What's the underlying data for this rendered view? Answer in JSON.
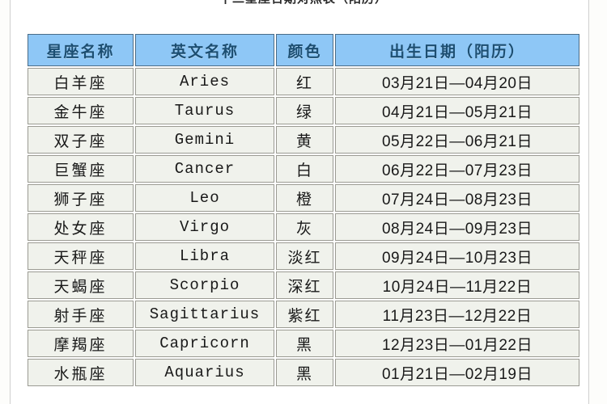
{
  "page": {
    "title_partial": "十二星座日期对照表（阳历）"
  },
  "table": {
    "name": "zodiac-date-table",
    "headers": [
      "星座名称",
      "英文名称",
      "颜色",
      "出生日期（阳历）"
    ],
    "rows": [
      {
        "cn": "白羊座",
        "en": "Aries",
        "color": "红",
        "date": "03月21日—04月20日"
      },
      {
        "cn": "金牛座",
        "en": "Taurus",
        "color": "绿",
        "date": "04月21日—05月21日"
      },
      {
        "cn": "双子座",
        "en": "Gemini",
        "color": "黄",
        "date": "05月22日—06月21日"
      },
      {
        "cn": "巨蟹座",
        "en": "Cancer",
        "color": "白",
        "date": "06月22日—07月23日"
      },
      {
        "cn": "狮子座",
        "en": "Leo",
        "color": "橙",
        "date": "07月24日—08月23日"
      },
      {
        "cn": "处女座",
        "en": "Virgo",
        "color": "灰",
        "date": "08月24日—09月23日"
      },
      {
        "cn": "天秤座",
        "en": "Libra",
        "color": "淡红",
        "date": "09月24日—10月23日"
      },
      {
        "cn": "天蝎座",
        "en": "Scorpio",
        "color": "深红",
        "date": "10月24日—11月22日"
      },
      {
        "cn": "射手座",
        "en": "Sagittarius",
        "color": "紫红",
        "date": "11月23日—12月22日"
      },
      {
        "cn": "摩羯座",
        "en": "Capricorn",
        "color": "黑",
        "date": "12月23日—01月22日"
      },
      {
        "cn": "水瓶座",
        "en": "Aquarius",
        "color": "黑",
        "date": "01月21日—02月19日"
      }
    ]
  },
  "colors": {
    "header_bg": "#8cc6f5",
    "header_text": "#1d4f73",
    "header_border": "#4a6d88",
    "cell_bg": "#eef0ea",
    "cell_border": "#9a9a92",
    "page_bg": "#ffffff",
    "canvas_bg": "#fdfdfb"
  }
}
